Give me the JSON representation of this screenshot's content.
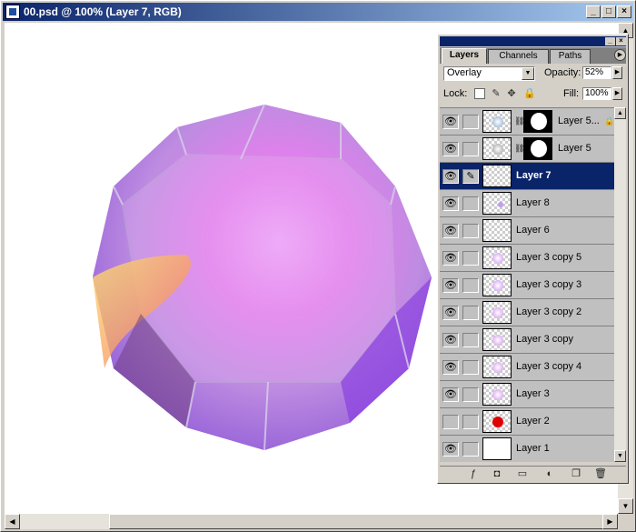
{
  "window": {
    "title": "00.psd @ 100% (Layer 7, RGB)",
    "buttons": {
      "minimize": "_",
      "maximize": "□",
      "close": "×"
    }
  },
  "canvas_image": {
    "description_icon": "purple-gem",
    "colors": {
      "main": "#b070e8",
      "pink": "#f080f0",
      "orange": "#f0a050"
    }
  },
  "palette": {
    "tabs": [
      {
        "label": "Layers",
        "active": true
      },
      {
        "label": "Channels",
        "active": false
      },
      {
        "label": "Paths",
        "active": false
      }
    ],
    "blend_mode": "Overlay",
    "opacity_label": "Opacity:",
    "opacity_value": "52%",
    "lock_label": "Lock:",
    "fill_label": "Fill:",
    "fill_value": "100%",
    "layers": [
      {
        "name": "Layer 5...",
        "visible": true,
        "has_mask": true,
        "locked": true,
        "thumb": "sparkle",
        "selected": false
      },
      {
        "name": "Layer 5",
        "visible": true,
        "has_mask": true,
        "locked": false,
        "thumb": "sparkle",
        "selected": false
      },
      {
        "name": "Layer 7",
        "visible": true,
        "has_mask": false,
        "locked": false,
        "thumb": "transparent",
        "selected": true,
        "brush": true
      },
      {
        "name": "Layer 8",
        "visible": true,
        "has_mask": false,
        "locked": false,
        "thumb": "stroke",
        "selected": false
      },
      {
        "name": "Layer 6",
        "visible": true,
        "has_mask": false,
        "locked": false,
        "thumb": "transparent",
        "selected": false
      },
      {
        "name": "Layer 3 copy 5",
        "visible": true,
        "has_mask": false,
        "locked": false,
        "thumb": "orb",
        "selected": false
      },
      {
        "name": "Layer 3 copy 3",
        "visible": true,
        "has_mask": false,
        "locked": false,
        "thumb": "orb",
        "selected": false
      },
      {
        "name": "Layer 3 copy 2",
        "visible": true,
        "has_mask": false,
        "locked": false,
        "thumb": "orb",
        "selected": false
      },
      {
        "name": "Layer 3 copy",
        "visible": true,
        "has_mask": false,
        "locked": false,
        "thumb": "orb",
        "selected": false
      },
      {
        "name": "Layer 3 copy 4",
        "visible": true,
        "has_mask": false,
        "locked": false,
        "thumb": "orb",
        "selected": false
      },
      {
        "name": "Layer 3",
        "visible": true,
        "has_mask": false,
        "locked": false,
        "thumb": "orb",
        "selected": false
      },
      {
        "name": "Layer 2",
        "visible": false,
        "has_mask": false,
        "locked": false,
        "thumb": "red-dot",
        "selected": false
      },
      {
        "name": "Layer 1",
        "visible": true,
        "has_mask": false,
        "locked": false,
        "thumb": "white",
        "selected": false
      }
    ]
  }
}
